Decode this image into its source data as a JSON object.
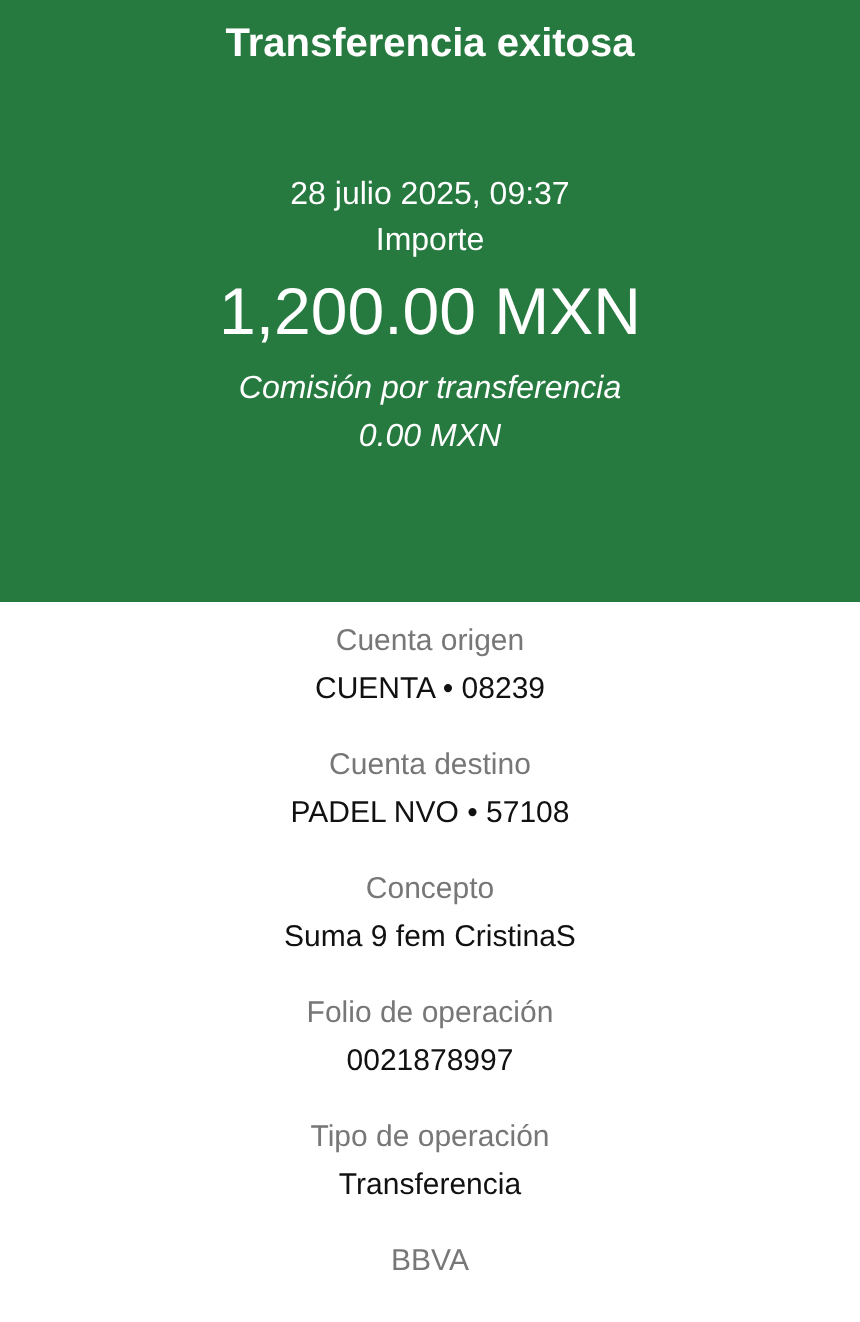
{
  "header": {
    "title": "Transferencia exitosa",
    "datetime": "28 julio 2025, 09:37",
    "amount_label": "Importe",
    "amount": "1,200.00 MXN",
    "commission_label": "Comisión por transferencia",
    "commission": "0.00 MXN"
  },
  "details": [
    {
      "label": "Cuenta origen",
      "value": "CUENTA • 08239"
    },
    {
      "label": "Cuenta destino",
      "value": "PADEL NVO • 57108"
    },
    {
      "label": "Concepto",
      "value": "Suma 9 fem CristinaS"
    },
    {
      "label": "Folio de operación",
      "value": "0021878997"
    },
    {
      "label": "Tipo de operación",
      "value": "Transferencia"
    }
  ],
  "footer": "BBVA"
}
